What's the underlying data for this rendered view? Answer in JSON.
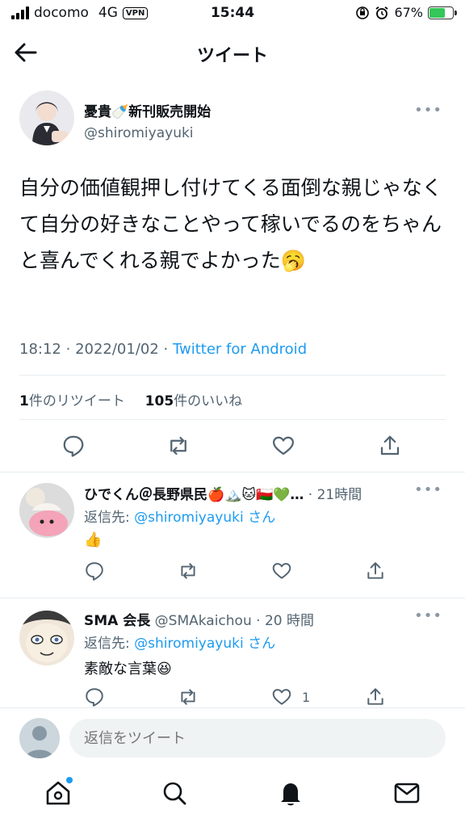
{
  "status_bar": {
    "carrier": "docomo",
    "network": "4G",
    "vpn": "VPN",
    "time": "15:44",
    "battery": "67%",
    "battery_level": 0.67
  },
  "header": {
    "title": "ツイート"
  },
  "tweet": {
    "author_name": "憂貴🍼新刊販売開始",
    "author_handle": "@shiromiyayuki",
    "text": "自分の価値観押し付けてくる面倒な親じゃなくて自分の好きなことやって稼いでるのをちゃんと喜んでくれる親でよかった🥱",
    "time": "18:12",
    "date": "2022/01/02",
    "source": "Twitter for Android",
    "retweet_count": "1",
    "retweet_label": "件のリツイート",
    "like_count": "105",
    "like_label": "件のいいね"
  },
  "replies": [
    {
      "name": "ひでくん＠長野県民🍎🏔️🐱🇴🇲💚…",
      "time": "21時間",
      "replying_to_label": "返信先:",
      "replying_to": "@shiromiyayuki",
      "replying_suffix": "さん",
      "text": "👍",
      "like_count": ""
    },
    {
      "name": "SMA 会長",
      "handle": "@SMAkaichou",
      "time": "20 時間",
      "replying_to_label": "返信先:",
      "replying_to": "@shiromiyayuki",
      "replying_suffix": "さん",
      "text": "素敵な言葉😆",
      "like_count": "1"
    }
  ],
  "compose": {
    "placeholder": "返信をツイート"
  },
  "icons": {
    "back": "arrow-left-icon",
    "more": "more-icon",
    "reply": "reply-icon",
    "retweet": "retweet-icon",
    "like": "heart-icon",
    "share": "share-icon",
    "home": "home-icon",
    "search": "search-icon",
    "notifications": "bell-icon",
    "messages": "mail-icon"
  },
  "colors": {
    "accent": "#1d9bf0",
    "secondary_text": "#536471"
  }
}
